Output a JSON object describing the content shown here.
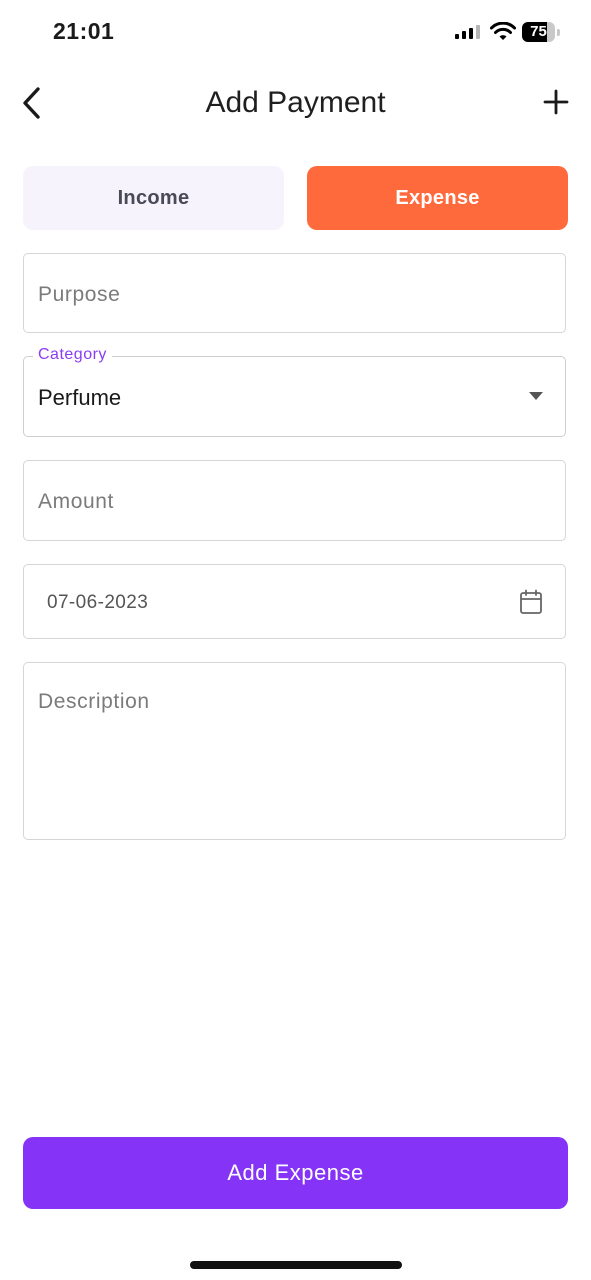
{
  "status_bar": {
    "time": "21:01",
    "battery_percent": 75,
    "battery_label": "75"
  },
  "header": {
    "title": "Add Payment"
  },
  "toggle": {
    "income_label": "Income",
    "expense_label": "Expense",
    "selected": "Expense",
    "selected_color": "#ff6a3d"
  },
  "form": {
    "purpose": {
      "placeholder": "Purpose",
      "value": ""
    },
    "category": {
      "label": "Category",
      "value": "Perfume"
    },
    "amount": {
      "placeholder": "Amount",
      "value": ""
    },
    "date": {
      "value": "07-06-2023"
    },
    "description": {
      "placeholder": "Description",
      "value": ""
    }
  },
  "submit": {
    "label": "Add Expense",
    "color": "#8534f7"
  },
  "icons": {
    "back": "chevron-left-icon",
    "add": "plus-icon",
    "dropdown": "caret-down-icon",
    "calendar": "calendar-icon"
  }
}
